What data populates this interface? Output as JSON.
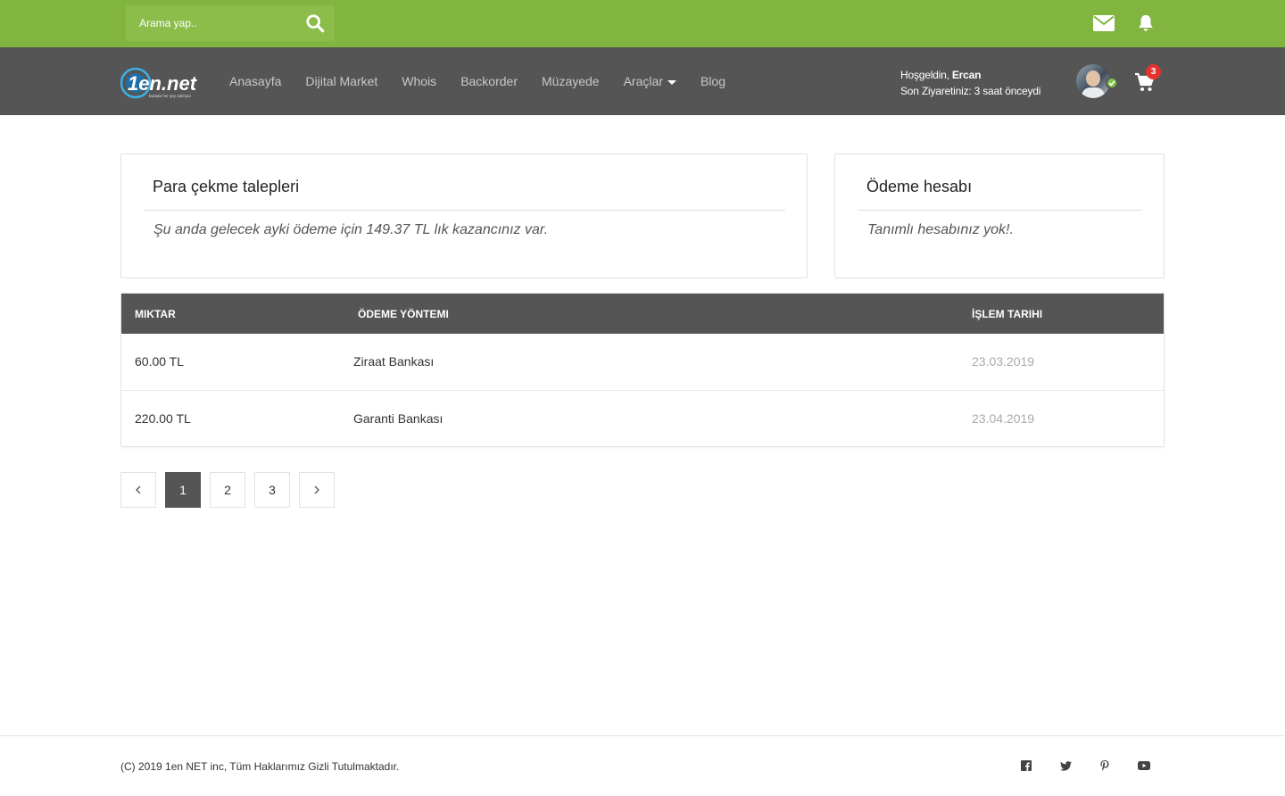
{
  "header": {
    "search_placeholder": "Arama yap..",
    "cart_count": "3",
    "welcome_prefix": "Hoşgeldin,",
    "user_name": "Ercan",
    "last_visit": "Son Ziyaretiniz: 3 saat önceydi"
  },
  "nav": {
    "items": [
      {
        "label": "Anasayfa"
      },
      {
        "label": "Dijital Market"
      },
      {
        "label": "Whois"
      },
      {
        "label": "Backorder"
      },
      {
        "label": "Müzayede"
      },
      {
        "label": "Araçlar"
      },
      {
        "label": "Blog"
      }
    ]
  },
  "logo": {
    "text": "1en.net",
    "tagline": "burada her şey satılıyor"
  },
  "withdrawals": {
    "title": "Para çekme talepleri",
    "message": "Şu anda gelecek ayki ödeme için 149.37 TL lık kazancınız var."
  },
  "payment_account": {
    "title": "Ödeme hesabı",
    "message": "Tanımlı hesabınız yok!."
  },
  "table": {
    "headers": {
      "amount": "MIKTAR",
      "method": "ÖDEME YÖNTEMI",
      "date": "İŞLEM TARIHI"
    },
    "rows": [
      {
        "amount": "60.00 TL",
        "method": "Ziraat Bankası",
        "date": "23.03.2019"
      },
      {
        "amount": "220.00 TL",
        "method": "Garanti Bankası",
        "date": "23.04.2019"
      }
    ]
  },
  "pagination": {
    "pages": [
      "1",
      "2",
      "3"
    ],
    "current": "1"
  },
  "footer": {
    "copyright": "(C) 2019 1en NET inc, Tüm Haklarımız Gizli Tutulmaktadır.",
    "social": [
      "facebook-icon",
      "twitter-icon",
      "pinterest-icon",
      "youtube-icon"
    ]
  },
  "colors": {
    "brand_green": "#82b440",
    "dark_bar": "#555555",
    "badge_red": "#e4322e",
    "online_green": "#7ec542"
  }
}
